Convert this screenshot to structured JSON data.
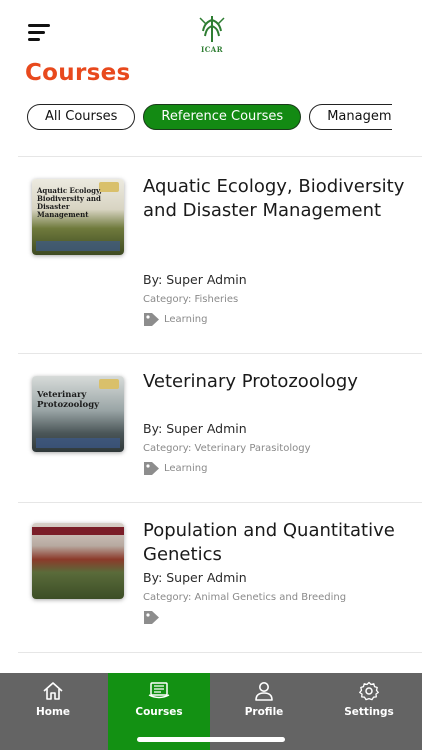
{
  "header": {
    "logo_text": "ICAR",
    "title": "Courses"
  },
  "tabs": [
    {
      "label": "All Courses",
      "active": false
    },
    {
      "label": "Reference Courses",
      "active": true
    },
    {
      "label": "Management",
      "active": false
    }
  ],
  "courses": [
    {
      "title": "Aquatic Ecology, Biodiversity and Disaster Management",
      "author": "By: Super Admin",
      "category": "Category: Fisheries",
      "tag": "Learning",
      "thumb_title": "Aquatic Ecology, Biodiversity and Disaster Management"
    },
    {
      "title": "Veterinary Protozoology",
      "author": "By: Super Admin",
      "category": "Category: Veterinary Parasitology",
      "tag": "Learning",
      "thumb_title": "Veterinary Protozoology"
    },
    {
      "title": "Population and Quantitative Genetics",
      "author": "By: Super Admin",
      "category": "Category: Animal Genetics and Breeding",
      "tag": "",
      "thumb_title": ""
    }
  ],
  "bottom_nav": [
    {
      "label": "Home",
      "icon": "home-icon",
      "active": false
    },
    {
      "label": "Courses",
      "icon": "book-icon",
      "active": true
    },
    {
      "label": "Profile",
      "icon": "user-icon",
      "active": false
    },
    {
      "label": "Settings",
      "icon": "gear-icon",
      "active": false
    }
  ],
  "colors": {
    "title_accent": "#e8491d",
    "active_green": "#139113",
    "nav_background": "#646464"
  }
}
